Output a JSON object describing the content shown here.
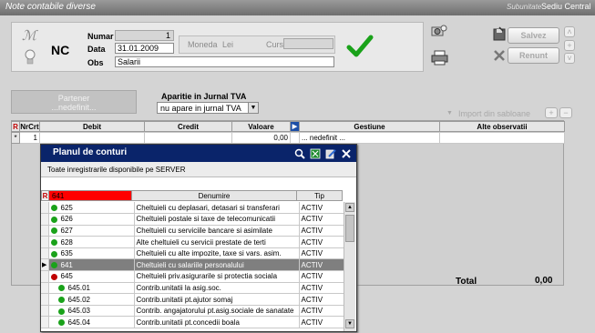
{
  "window": {
    "title": "Note contabile diverse",
    "subunit_label": "Subunitate",
    "subunit_value": "Sediu Central"
  },
  "header": {
    "doc_type": "NC",
    "numar_label": "Numar",
    "numar_value": "1",
    "data_label": "Data",
    "data_value": "31.01.2009",
    "obs_label": "Obs",
    "obs_value": "Salarii",
    "moneda_label": "Moneda",
    "moneda_value": "Lei",
    "curs_label": "Curs",
    "curs_value": ""
  },
  "buttons": {
    "salvez": "Salvez",
    "renunt": "Renunt",
    "import_sabloane": "Import din sabloane",
    "plus": "+",
    "minus": "−"
  },
  "partener": {
    "label": "Partener",
    "value": "...nedefinit..."
  },
  "jurnal": {
    "label": "Aparitie in Jurnal TVA",
    "selected": "nu apare in jurnal TVA"
  },
  "grid": {
    "columns": [
      "R",
      "NrCrt",
      "Debit",
      "Credit",
      "Valoare",
      "Gestiune",
      "Alte observatii"
    ],
    "row": {
      "marker": "*",
      "nrcrt": "1",
      "debit": "",
      "credit": "",
      "valoare": "0,00",
      "gestiune": "... nedefinit ...",
      "observatii": ""
    },
    "total_label": "Total",
    "total_value": "0,00"
  },
  "popup": {
    "title": "Planul de conturi",
    "info": "Toate inregistrarile disponibile pe SERVER",
    "filter_value": "641",
    "columns": [
      "R",
      "",
      "Denumire",
      "Tip"
    ],
    "rows": [
      {
        "cont": "625",
        "denumire": "Cheltuieli cu deplasari, detasari si transferari",
        "tip": "ACTIV",
        "dot": "green",
        "indent": false,
        "selected": false
      },
      {
        "cont": "626",
        "denumire": "Cheltuieli postale si taxe de telecomunicatii",
        "tip": "ACTIV",
        "dot": "green",
        "indent": false,
        "selected": false
      },
      {
        "cont": "627",
        "denumire": "Cheltuieli cu serviciile bancare si asimilate",
        "tip": "ACTIV",
        "dot": "green",
        "indent": false,
        "selected": false
      },
      {
        "cont": "628",
        "denumire": "Alte cheltuieli cu servicii prestate de terti",
        "tip": "ACTIV",
        "dot": "green",
        "indent": false,
        "selected": false
      },
      {
        "cont": "635",
        "denumire": "Cheltuieli cu alte impozite, taxe si vars. asim.",
        "tip": "ACTIV",
        "dot": "green",
        "indent": false,
        "selected": false
      },
      {
        "cont": "641",
        "denumire": "Cheltuieli cu salariile personalului",
        "tip": "ACTIV",
        "dot": "green",
        "indent": false,
        "selected": true
      },
      {
        "cont": "645",
        "denumire": "Cheltuieli priv.asigurarile si protectia sociala",
        "tip": "ACTIV",
        "dot": "red",
        "indent": false,
        "selected": false
      },
      {
        "cont": "645.01",
        "denumire": "Contrib.unitatii la asig.soc.",
        "tip": "ACTIV",
        "dot": "green",
        "indent": true,
        "selected": false
      },
      {
        "cont": "645.02",
        "denumire": "Contrib.unitatii pt.ajutor somaj",
        "tip": "ACTIV",
        "dot": "green",
        "indent": true,
        "selected": false
      },
      {
        "cont": "645.03",
        "denumire": "Contrib. angajatorului pt.asig.sociale de sanatate",
        "tip": "ACTIV",
        "dot": "green",
        "indent": true,
        "selected": false
      },
      {
        "cont": "645.04",
        "denumire": "Contrib.unitatii pt.concedii boala",
        "tip": "ACTIV",
        "dot": "green",
        "indent": true,
        "selected": false
      }
    ]
  },
  "colors": {
    "title_bg": "#0a246a",
    "selected_row": "#7f7f7f",
    "dot_green": "#1aa21a",
    "dot_red": "#c00000",
    "check": "#1aa21a",
    "filter_red": "#ff0000"
  },
  "icons": [
    "script-m-icon",
    "lightbulb-icon",
    "checkmark-icon",
    "printer-icon",
    "camera-icon",
    "save-icon",
    "cancel-x-icon",
    "search-icon",
    "excel-icon",
    "edit-icon",
    "close-icon"
  ]
}
